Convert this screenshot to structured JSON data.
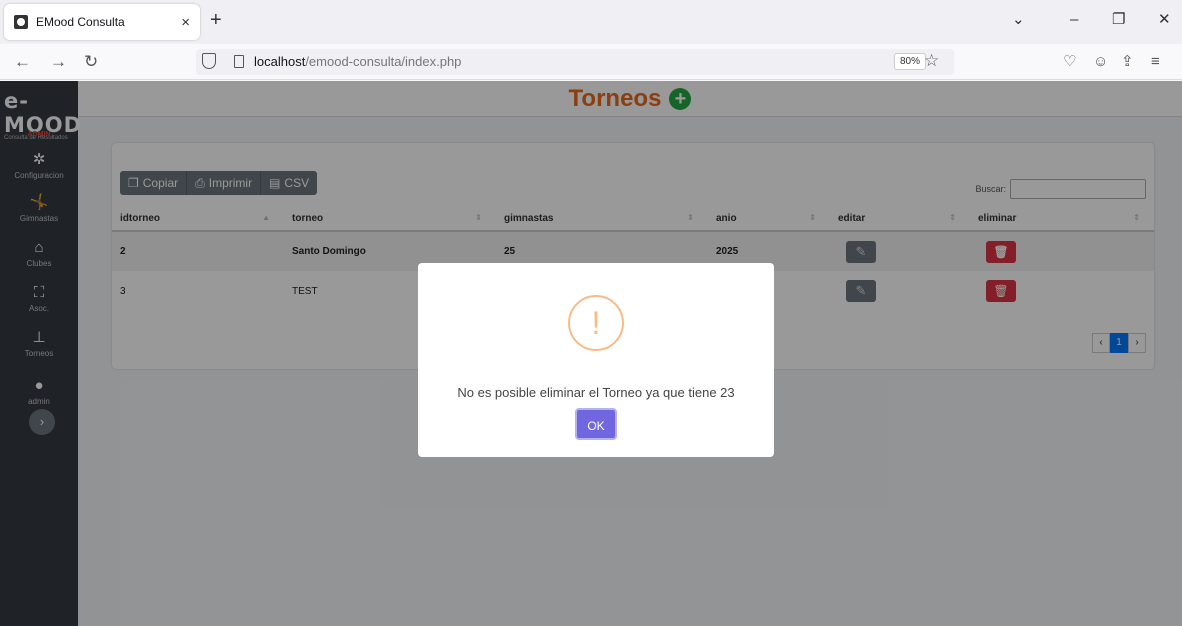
{
  "browser": {
    "tab_title": "EMood Consulta",
    "tab_close": "×",
    "new_tab": "+",
    "url_host": "localhost",
    "url_path": "/emood-consulta/index.php",
    "zoom": "80%"
  },
  "sidebar": {
    "brand": "e-MOOD",
    "brand_sub": "Consulta de Resultados",
    "role": "ADMIN",
    "items": [
      {
        "label": "Configuracion",
        "icon": "gear-icon"
      },
      {
        "label": "Gimnastas",
        "icon": "gymnast-icon"
      },
      {
        "label": "Clubes",
        "icon": "building-icon"
      },
      {
        "label": "Asoc.",
        "icon": "network-icon"
      },
      {
        "label": "Torneos",
        "icon": "sitemap-icon"
      },
      {
        "label": "admin",
        "icon": "user-icon"
      }
    ],
    "toggle": "›"
  },
  "header": {
    "title": "Torneos"
  },
  "toolbar": {
    "copy": "Copiar",
    "print": "Imprimir",
    "csv": "CSV",
    "search_label": "Buscar:"
  },
  "table": {
    "columns": [
      "idtorneo",
      "torneo",
      "gimnastas",
      "anio",
      "editar",
      "eliminar"
    ],
    "rows": [
      {
        "idtorneo": "2",
        "torneo": "Santo Domingo",
        "gimnastas": "25",
        "anio": "2025"
      },
      {
        "idtorneo": "3",
        "torneo": "TEST",
        "gimnastas": "",
        "anio": ""
      }
    ]
  },
  "pagination": {
    "prev": "‹",
    "page": "1",
    "next": "›"
  },
  "modal": {
    "icon": "!",
    "message": "No es posible eliminar el Torneo ya que tiene 23",
    "ok": "OK"
  }
}
